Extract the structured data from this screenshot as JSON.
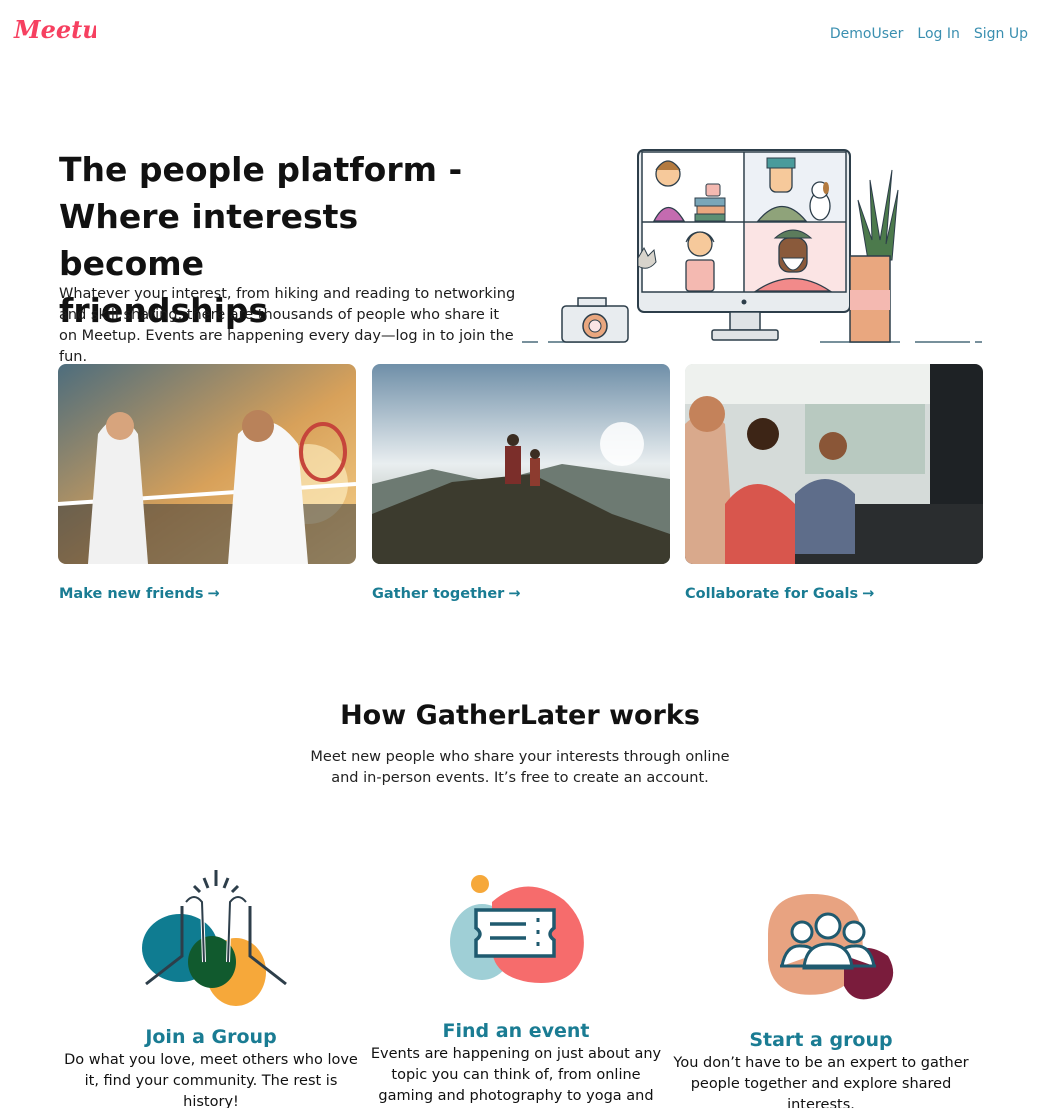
{
  "header": {
    "logo_text": "Meetup",
    "nav": {
      "demo_user": "DemoUser",
      "log_in": "Log In",
      "sign_up": "Sign Up"
    }
  },
  "hero": {
    "title_lines": [
      "The people platform -",
      "Where interests become",
      "friendships"
    ],
    "subtitle": "Whatever your interest, from hiking and reading to networking and skill sharing, there are thousands of people who share it on Meetup. Events are happening every day—log in to join the fun."
  },
  "cards": [
    {
      "link": "Make new friends",
      "arrow": "→"
    },
    {
      "link": "Gather together",
      "arrow": "→"
    },
    {
      "link": "Collaborate for Goals",
      "arrow": "→"
    }
  ],
  "how": {
    "title": "How GatherLater works",
    "subtitle": "Meet new people who share your interests through online and in-person events. It’s free to create an account."
  },
  "features": [
    {
      "title": "Join a Group",
      "desc": "Do what you love, meet others who love it, find your community. The rest is history!"
    },
    {
      "title": "Find an event",
      "desc": "Events are happening on just about any topic you can think of, from online gaming and photography to yoga and hiking."
    },
    {
      "title": "Start a group",
      "desc": "You don’t have to be an expert to gather people together and explore shared interests."
    }
  ],
  "colors": {
    "brand": "#f64060",
    "nav_link": "#3a8fb0",
    "accent_teal": "#1a7c93"
  }
}
